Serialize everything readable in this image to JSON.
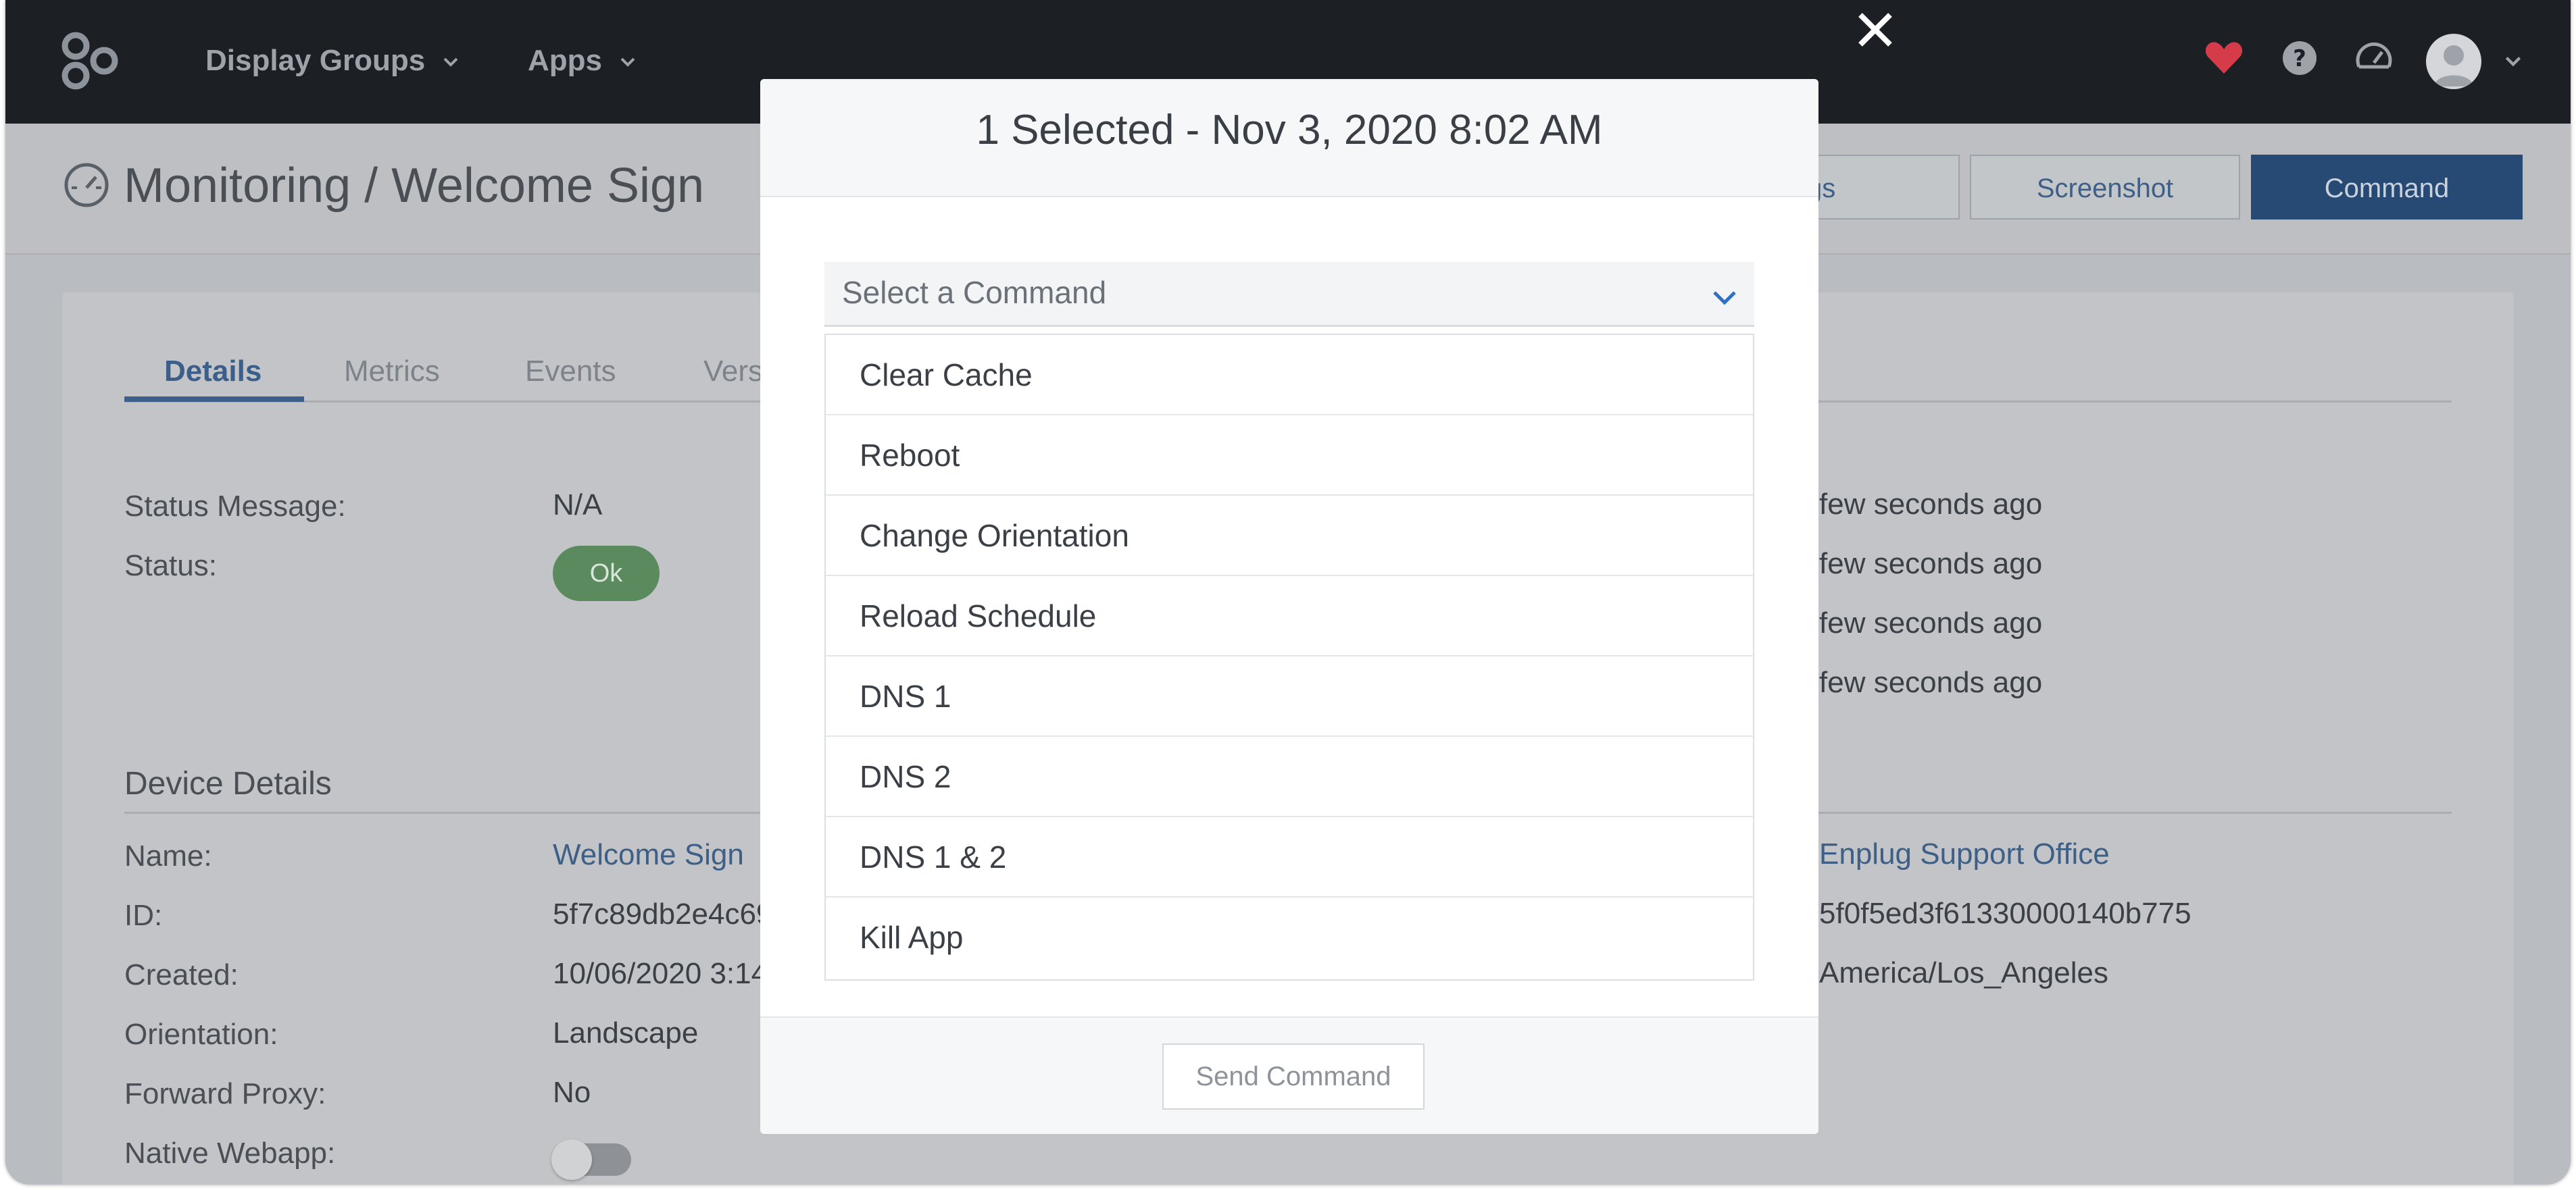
{
  "navbar": {
    "logo_icon": "enplug-logo-icon",
    "menus": [
      {
        "label": "Display Groups"
      },
      {
        "label": "Apps"
      }
    ],
    "icons": [
      "heart-icon",
      "help-icon",
      "dashboard-icon"
    ],
    "heart_color": "#d63b4a"
  },
  "page": {
    "title": "Monitoring / Welcome Sign",
    "buttons": {
      "logs": "gs",
      "screenshot": "Screenshot",
      "command": "Command"
    },
    "accent": "#2d5b96"
  },
  "tabs": [
    {
      "label": "Details"
    },
    {
      "label": "Metrics"
    },
    {
      "label": "Events"
    },
    {
      "label": "Vers"
    }
  ],
  "status": {
    "message_label": "Status Message:",
    "message_value": "N/A",
    "status_label": "Status:",
    "status_value": "Ok",
    "status_color": "#5b8a5e",
    "times": [
      "few seconds ago",
      "few seconds ago",
      "few seconds ago",
      "few seconds ago"
    ]
  },
  "device": {
    "section_title": "Device Details",
    "rows": [
      {
        "label": "Name:",
        "value": "Welcome Sign"
      },
      {
        "label": "ID:",
        "value": "5f7c89db2e4c69"
      },
      {
        "label": "Created:",
        "value": "10/06/2020 3:14"
      },
      {
        "label": "Orientation:",
        "value": "Landscape"
      },
      {
        "label": "Forward Proxy:",
        "value": "No"
      },
      {
        "label": "Native Webapp:",
        "value": ""
      }
    ],
    "right_values": [
      "Enplug Support Office",
      "5f0f5ed3f61330000140b775",
      "America/Los_Angeles"
    ]
  },
  "modal": {
    "title": "1 Selected - Nov 3, 2020 8:02 AM",
    "select_placeholder": "Select a Command",
    "options": [
      {
        "label": "Clear Cache"
      },
      {
        "label": "Reboot"
      },
      {
        "label": "Change Orientation"
      },
      {
        "label": "Reload Schedule"
      },
      {
        "label": "DNS 1"
      },
      {
        "label": "DNS 2"
      },
      {
        "label": "DNS 1 & 2"
      },
      {
        "label": "Kill App"
      }
    ],
    "send_label": "Send Command"
  }
}
